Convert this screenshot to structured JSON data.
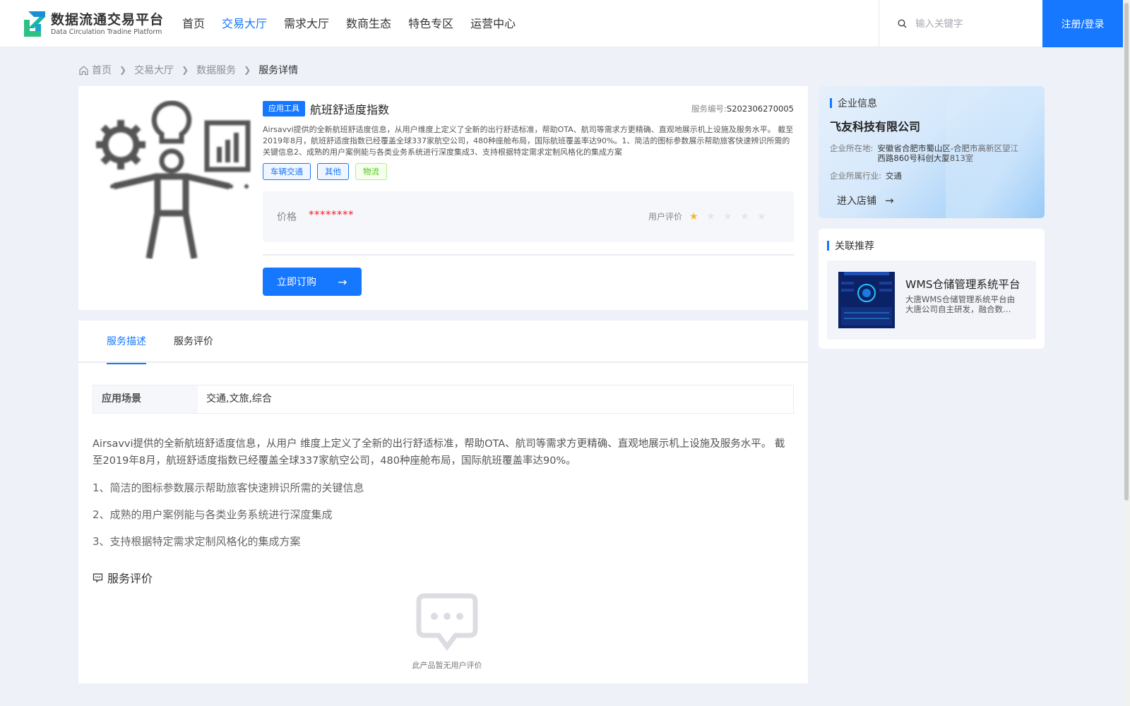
{
  "header": {
    "logo_title": "数据流通交易平台",
    "logo_subtitle": "Data Circulation Tradine Platform",
    "nav": [
      "首页",
      "交易大厅",
      "需求大厅",
      "数商生态",
      "特色专区",
      "运营中心"
    ],
    "active_nav": "交易大厅",
    "search_placeholder": "输入关键字",
    "login_label": "注册/登录"
  },
  "breadcrumb": [
    "首页",
    "交易大厅",
    "数据服务",
    "服务详情"
  ],
  "product": {
    "type_tag": "应用工具",
    "title": "航班舒适度指数",
    "service_no_label": "服务编号:",
    "service_no": "S202306270005",
    "description": "Airsavvi提供的全新航班舒适度信息，从用户维度上定义了全新的出行舒适标准，帮助OTA、航司等需求方更精确、直观地展示机上设施及服务水平。 截至2019年8月，航班舒适度指数已经覆盖全球337家航空公司，480种座舱布局，国际航班覆盖率达90%。1、简洁的图标参数展示帮助旅客快速辨识所需的关键信息2、成熟的用户案例能与各类业务系统进行深度集成3、支持根据特定需求定制风格化的集成方案",
    "tags": [
      {
        "label": "车辆交通",
        "color": "blue"
      },
      {
        "label": "其他",
        "color": "blue"
      },
      {
        "label": "物流",
        "color": "green"
      }
    ],
    "price_label": "价格",
    "price_value": "********",
    "rating_label": "用户评价",
    "rating": 1,
    "rating_max": 5,
    "subscribe_label": "立即订购"
  },
  "tabs": [
    "服务描述",
    "服务评价"
  ],
  "active_tab": "服务描述",
  "detail": {
    "scene_key": "应用场景",
    "scene_value": "交通,文旅,综合",
    "paragraph": "Airsavvi提供的全新航班舒适度信息，从用户 维度上定义了全新的出行舒适标准，帮助OTA、航司等需求方更精确、直观地展示机上设施及服务水平。 截至2019年8月，航班舒适度指数已经覆盖全球337家航空公司，480种座舱布局，国际航班覆盖率达90%。",
    "points": [
      "1、简洁的图标参数展示帮助旅客快速辨识所需的关键信息",
      "2、成熟的用户案例能与各类业务系统进行深度集成",
      "3、支持根据特定需求定制风格化的集成方案"
    ],
    "eval_title": "服务评价",
    "empty_text": "此产品暂无用户评价"
  },
  "company": {
    "section_title": "企业信息",
    "name": "飞友科技有限公司",
    "location_label": "企业所在地:",
    "location": "安徽省合肥市蜀山区-合肥市高新区望江西路860号科创大厦813室",
    "industry_label": "企业所属行业:",
    "industry": "交通",
    "enter_shop": "进入店铺"
  },
  "recommend": {
    "section_title": "关联推荐",
    "item_title": "WMS仓储管理系统平台",
    "item_desc": "大唐WMS仓储管理系统平台由大唐公司自主研发，融合数…"
  },
  "colors": {
    "accent": "#1677ff",
    "price": "#f5222d",
    "star": "#f7b52c",
    "tag_green": "#52c41a"
  }
}
